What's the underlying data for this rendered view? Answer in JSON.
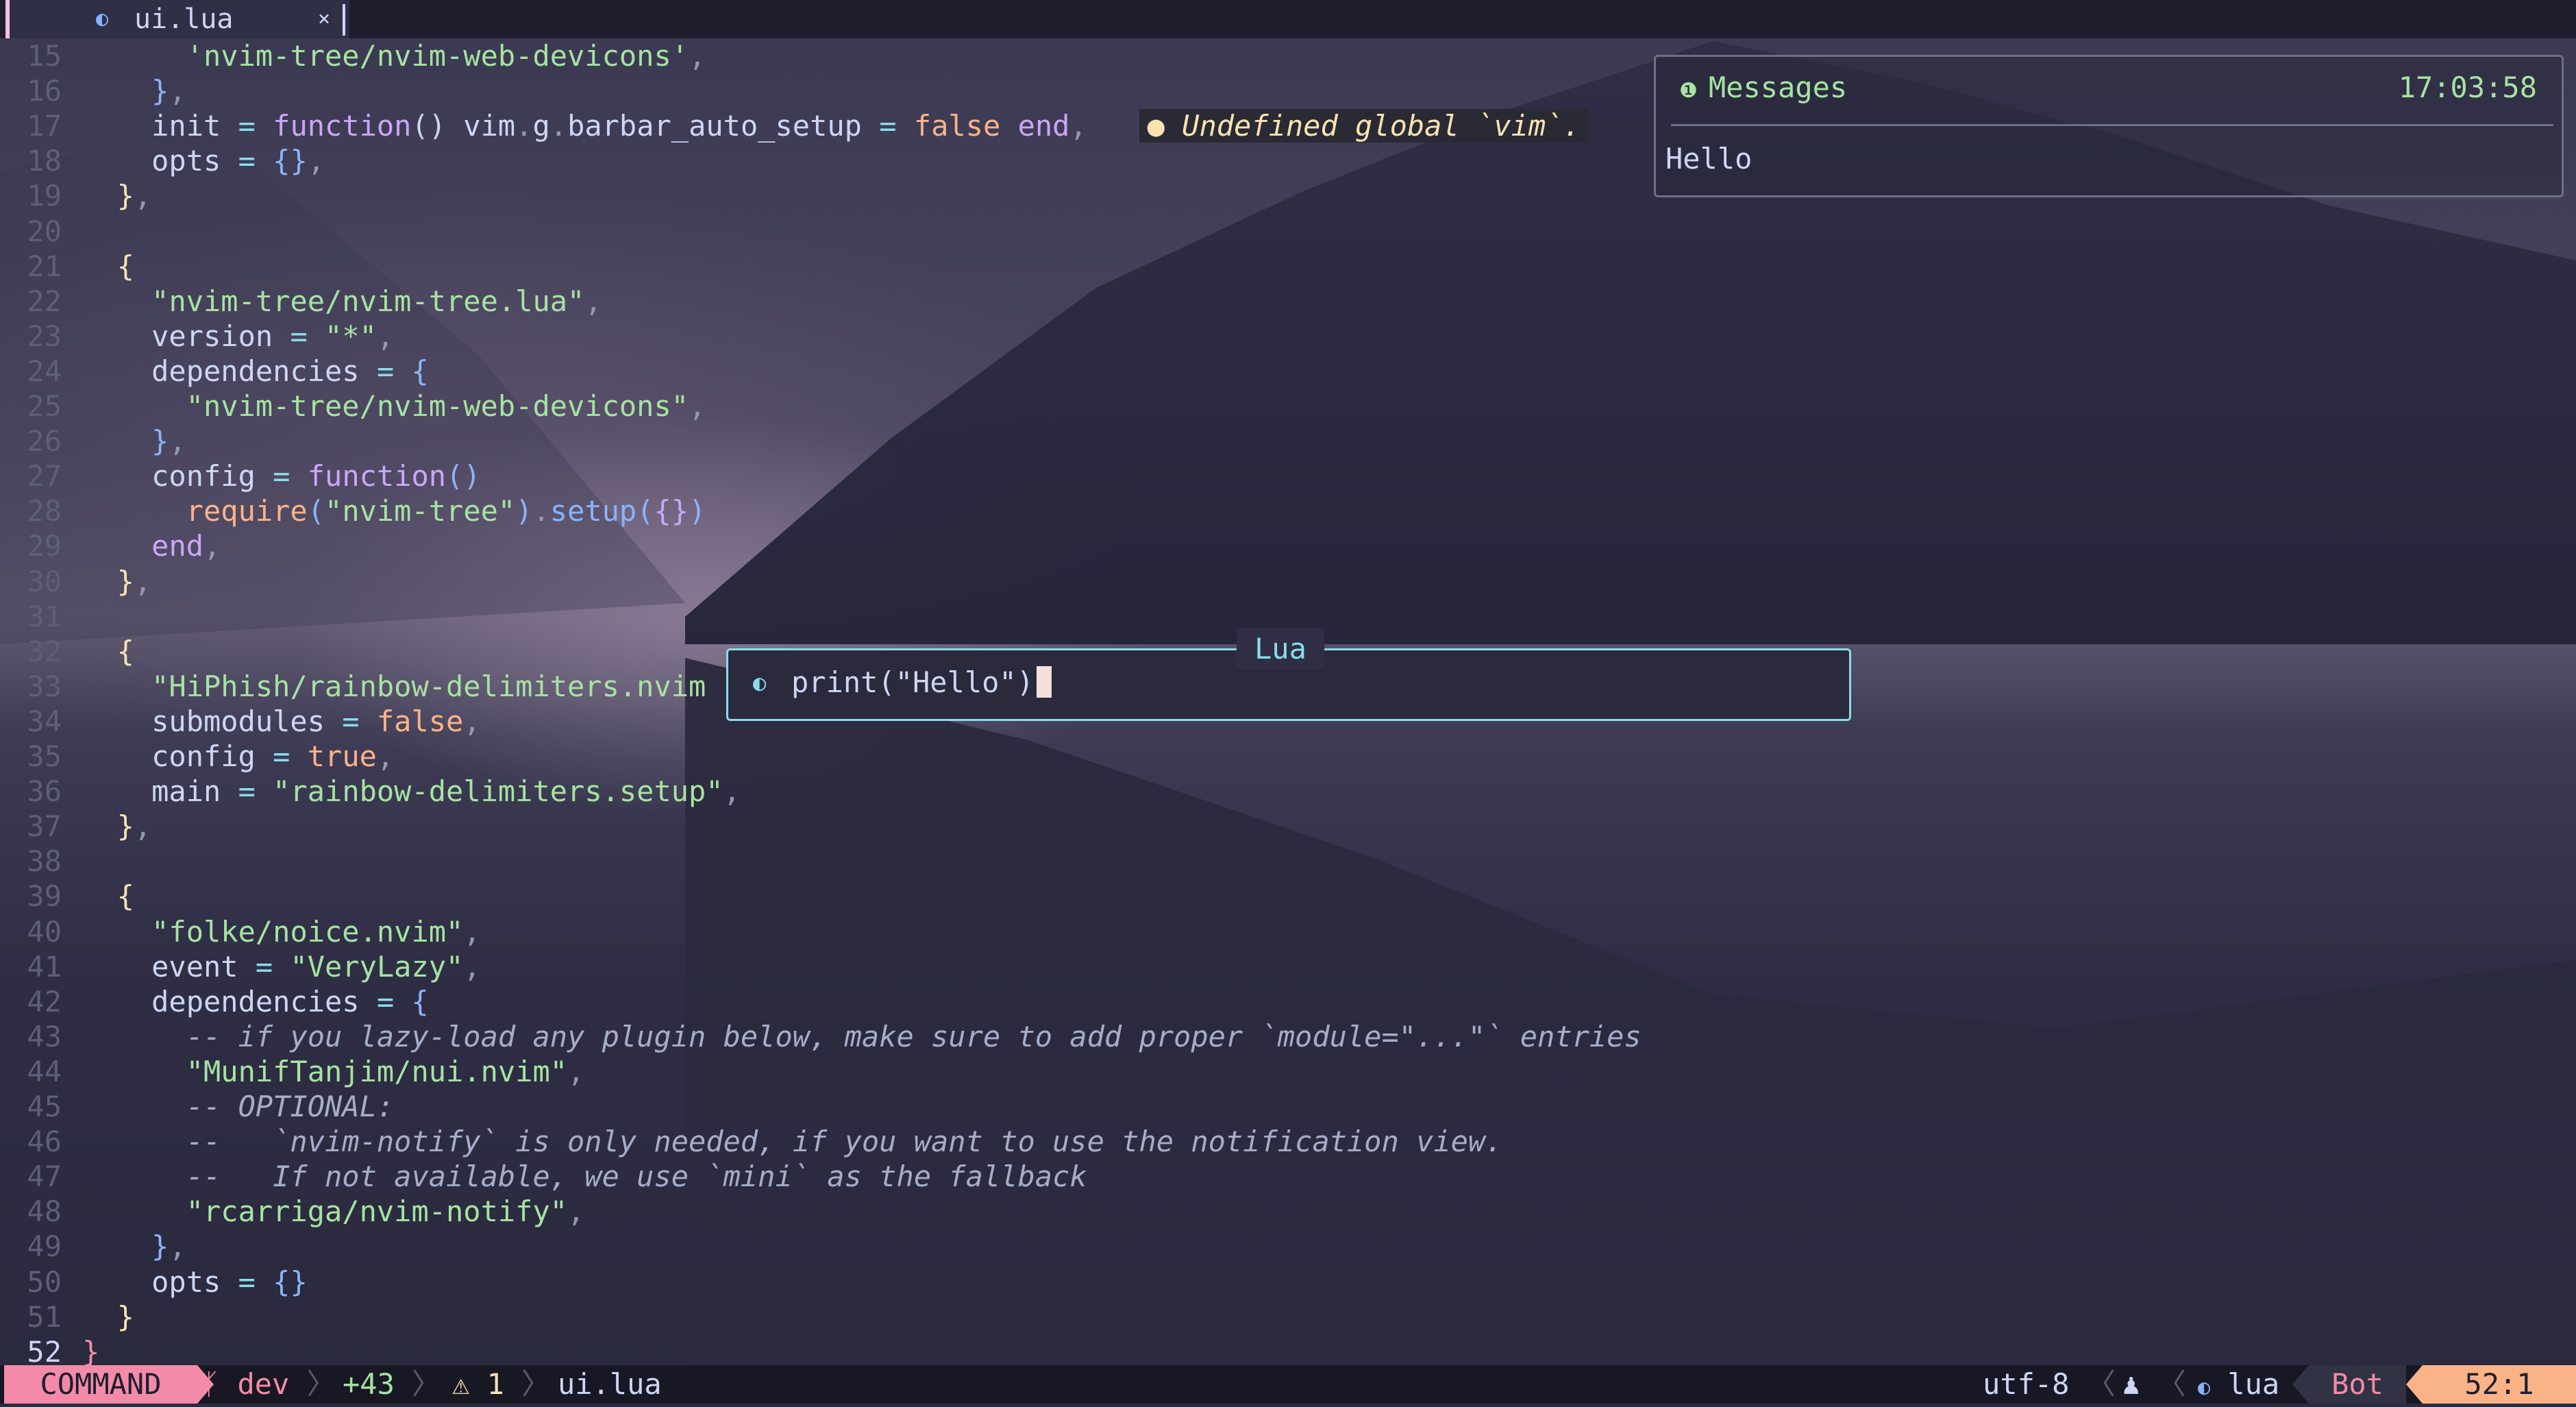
{
  "tab": {
    "icon": "lua-icon",
    "name": "ui.lua",
    "close": "×"
  },
  "editor": {
    "lines": [
      {
        "n": "15",
        "parts": [
          [
            "      ",
            "fg"
          ],
          [
            "'nvim-tree/nvim-web-devicons'",
            "str"
          ],
          [
            ",",
            "pun"
          ]
        ]
      },
      {
        "n": "16",
        "parts": [
          [
            "    ",
            "fg"
          ],
          [
            "}",
            "br2"
          ],
          [
            ",",
            "pun"
          ]
        ]
      },
      {
        "n": "17",
        "parts": [
          [
            "    init ",
            "fg"
          ],
          [
            "=",
            "op"
          ],
          [
            " ",
            "fg"
          ],
          [
            "function",
            "kw"
          ],
          [
            "() vim",
            "fg"
          ],
          [
            ".",
            "pun"
          ],
          [
            "g",
            "fg"
          ],
          [
            ".",
            "pun"
          ],
          [
            "barbar_auto_setup ",
            "fg"
          ],
          [
            "=",
            "op"
          ],
          [
            " ",
            "fg"
          ],
          [
            "false",
            "cst"
          ],
          [
            " ",
            "fg"
          ],
          [
            "end",
            "kw"
          ],
          [
            ",",
            "pun"
          ],
          [
            "   ",
            "fg"
          ]
        ],
        "diag": "Undefined global `vim`."
      },
      {
        "n": "18",
        "parts": [
          [
            "    opts ",
            "fg"
          ],
          [
            "=",
            "op"
          ],
          [
            " ",
            "fg"
          ],
          [
            "{}",
            "br2"
          ],
          [
            ",",
            "pun"
          ]
        ]
      },
      {
        "n": "19",
        "parts": [
          [
            "  ",
            "fg"
          ],
          [
            "}",
            "br1"
          ],
          [
            ",",
            "pun"
          ]
        ]
      },
      {
        "n": "20",
        "parts": []
      },
      {
        "n": "21",
        "parts": [
          [
            "  ",
            "fg"
          ],
          [
            "{",
            "br1"
          ]
        ]
      },
      {
        "n": "22",
        "parts": [
          [
            "    ",
            "fg"
          ],
          [
            "\"nvim-tree/nvim-tree.lua\"",
            "str"
          ],
          [
            ",",
            "pun"
          ]
        ]
      },
      {
        "n": "23",
        "parts": [
          [
            "    version ",
            "fg"
          ],
          [
            "=",
            "op"
          ],
          [
            " ",
            "fg"
          ],
          [
            "\"*\"",
            "str"
          ],
          [
            ",",
            "pun"
          ]
        ]
      },
      {
        "n": "24",
        "parts": [
          [
            "    dependencies ",
            "fg"
          ],
          [
            "=",
            "op"
          ],
          [
            " ",
            "fg"
          ],
          [
            "{",
            "br2"
          ]
        ]
      },
      {
        "n": "25",
        "parts": [
          [
            "      ",
            "fg"
          ],
          [
            "\"nvim-tree/nvim-web-devicons\"",
            "str"
          ],
          [
            ",",
            "pun"
          ]
        ]
      },
      {
        "n": "26",
        "parts": [
          [
            "    ",
            "fg"
          ],
          [
            "}",
            "br2"
          ],
          [
            ",",
            "pun"
          ]
        ]
      },
      {
        "n": "27",
        "parts": [
          [
            "    config ",
            "fg"
          ],
          [
            "=",
            "op"
          ],
          [
            " ",
            "fg"
          ],
          [
            "function",
            "kw"
          ],
          [
            "()",
            "fn"
          ]
        ]
      },
      {
        "n": "28",
        "parts": [
          [
            "      ",
            "fg"
          ],
          [
            "require",
            "cst"
          ],
          [
            "(",
            "br2"
          ],
          [
            "\"nvim-tree\"",
            "str"
          ],
          [
            ")",
            "br2"
          ],
          [
            ".",
            "pun"
          ],
          [
            "setup",
            "fn"
          ],
          [
            "(",
            "br2"
          ],
          [
            "{}",
            "kw"
          ],
          [
            ")",
            "br2"
          ]
        ]
      },
      {
        "n": "29",
        "parts": [
          [
            "    ",
            "fg"
          ],
          [
            "end",
            "kw"
          ],
          [
            ",",
            "pun"
          ]
        ]
      },
      {
        "n": "30",
        "parts": [
          [
            "  ",
            "fg"
          ],
          [
            "}",
            "br1"
          ],
          [
            ",",
            "pun"
          ]
        ]
      },
      {
        "n": "31",
        "parts": []
      },
      {
        "n": "32",
        "parts": [
          [
            "  ",
            "fg"
          ],
          [
            "{",
            "br1"
          ]
        ]
      },
      {
        "n": "33",
        "parts": [
          [
            "    ",
            "fg"
          ],
          [
            "\"HiPhish/rainbow-delimiters.nvim",
            "str"
          ]
        ]
      },
      {
        "n": "34",
        "parts": [
          [
            "    submodules ",
            "fg"
          ],
          [
            "=",
            "op"
          ],
          [
            " ",
            "fg"
          ],
          [
            "false",
            "cst"
          ],
          [
            ",",
            "pun"
          ]
        ]
      },
      {
        "n": "35",
        "parts": [
          [
            "    config ",
            "fg"
          ],
          [
            "=",
            "op"
          ],
          [
            " ",
            "fg"
          ],
          [
            "true",
            "cst"
          ],
          [
            ",",
            "pun"
          ]
        ]
      },
      {
        "n": "36",
        "parts": [
          [
            "    main ",
            "fg"
          ],
          [
            "=",
            "op"
          ],
          [
            " ",
            "fg"
          ],
          [
            "\"rainbow-delimiters.setup\"",
            "str"
          ],
          [
            ",",
            "pun"
          ]
        ]
      },
      {
        "n": "37",
        "parts": [
          [
            "  ",
            "fg"
          ],
          [
            "}",
            "br1"
          ],
          [
            ",",
            "pun"
          ]
        ]
      },
      {
        "n": "38",
        "parts": []
      },
      {
        "n": "39",
        "parts": [
          [
            "  ",
            "fg"
          ],
          [
            "{",
            "br1"
          ]
        ]
      },
      {
        "n": "40",
        "parts": [
          [
            "    ",
            "fg"
          ],
          [
            "\"folke/noice.nvim\"",
            "str"
          ],
          [
            ",",
            "pun"
          ]
        ]
      },
      {
        "n": "41",
        "parts": [
          [
            "    event ",
            "fg"
          ],
          [
            "=",
            "op"
          ],
          [
            " ",
            "fg"
          ],
          [
            "\"VeryLazy\"",
            "str"
          ],
          [
            ",",
            "pun"
          ]
        ]
      },
      {
        "n": "42",
        "parts": [
          [
            "    dependencies ",
            "fg"
          ],
          [
            "=",
            "op"
          ],
          [
            " ",
            "fg"
          ],
          [
            "{",
            "br2"
          ]
        ]
      },
      {
        "n": "43",
        "parts": [
          [
            "      ",
            "fg"
          ],
          [
            "-- if you lazy-load any plugin below, make sure to add proper `module=\"...\"` entries",
            "cm"
          ]
        ]
      },
      {
        "n": "44",
        "parts": [
          [
            "      ",
            "fg"
          ],
          [
            "\"MunifTanjim/nui.nvim\"",
            "str"
          ],
          [
            ",",
            "pun"
          ]
        ]
      },
      {
        "n": "45",
        "parts": [
          [
            "      ",
            "fg"
          ],
          [
            "-- OPTIONAL:",
            "cm"
          ]
        ]
      },
      {
        "n": "46",
        "parts": [
          [
            "      ",
            "fg"
          ],
          [
            "--   `nvim-notify` is only needed, if you want to use the notification view.",
            "cm"
          ]
        ]
      },
      {
        "n": "47",
        "parts": [
          [
            "      ",
            "fg"
          ],
          [
            "--   If not available, we use `mini` as the fallback",
            "cm"
          ]
        ]
      },
      {
        "n": "48",
        "parts": [
          [
            "      ",
            "fg"
          ],
          [
            "\"rcarriga/nvim-notify\"",
            "str"
          ],
          [
            ",",
            "pun"
          ]
        ]
      },
      {
        "n": "49",
        "parts": [
          [
            "    ",
            "fg"
          ],
          [
            "}",
            "br2"
          ],
          [
            ",",
            "pun"
          ]
        ]
      },
      {
        "n": "50",
        "parts": [
          [
            "    opts ",
            "fg"
          ],
          [
            "=",
            "op"
          ],
          [
            " ",
            "fg"
          ],
          [
            "{}",
            "br2"
          ]
        ]
      },
      {
        "n": "51",
        "parts": [
          [
            "  ",
            "fg"
          ],
          [
            "}",
            "br1"
          ]
        ]
      },
      {
        "n": "52",
        "parts": [
          [
            "}",
            "br3"
          ]
        ],
        "current": true
      }
    ]
  },
  "messages": {
    "icon": "info-icon",
    "title": "Messages",
    "time": "17:03:58",
    "body": "Hello"
  },
  "cmdline": {
    "title": "Lua",
    "icon": "lua-icon",
    "text": "print(\"Hello\")"
  },
  "status": {
    "mode": "COMMAND",
    "branch": " dev",
    "branch_icon": "git-branch-icon",
    "diff_added": "+43",
    "warnings": "1",
    "warn_icon": "warning-icon",
    "file": "ui.lua",
    "encoding": "utf-8",
    "lsp_icon": "lsp-icon",
    "filetype": "lua",
    "position_label": "Bot",
    "position": "52:1"
  }
}
